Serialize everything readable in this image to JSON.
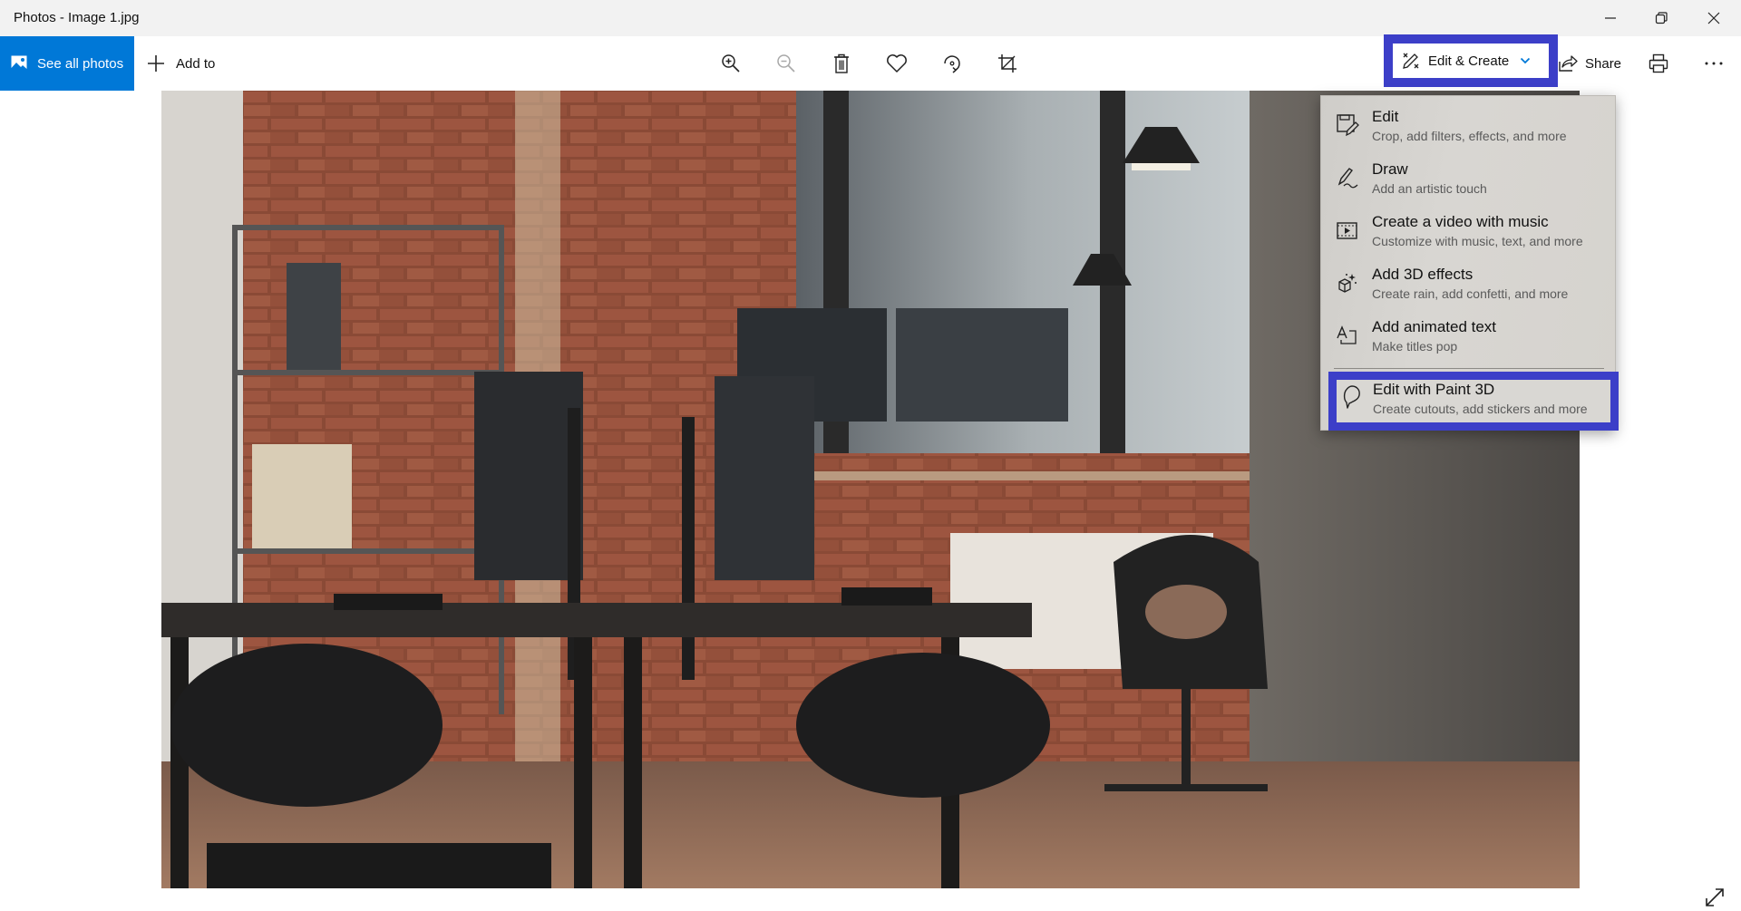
{
  "window": {
    "title": "Photos - Image 1.jpg",
    "controls": [
      {
        "name": "minimize",
        "icon": "minimize-icon"
      },
      {
        "name": "restore",
        "icon": "restore-icon"
      },
      {
        "name": "close",
        "icon": "close-icon"
      }
    ]
  },
  "toolbar": {
    "see_all_photos": "See all photos",
    "add_to": "Add to",
    "icons": [
      "zoom-in-icon",
      "zoom-out-icon",
      "delete-icon",
      "favorite-heart-icon",
      "rotate-icon",
      "crop-icon"
    ],
    "edit_create": "Edit & Create",
    "share": "Share",
    "print": "print-icon",
    "more": "more-options-icon"
  },
  "menu": {
    "items": [
      {
        "title": "Edit",
        "subtitle": "Crop, add filters, effects, and more",
        "icon": "edit-icon"
      },
      {
        "title": "Draw",
        "subtitle": "Add an artistic touch",
        "icon": "draw-pen-icon"
      },
      {
        "title": "Create a video with music",
        "subtitle": "Customize with music, text, and more",
        "icon": "video-icon"
      },
      {
        "title": "Add 3D effects",
        "subtitle": "Create rain, add confetti, and more",
        "icon": "3d-effects-icon"
      },
      {
        "title": "Add animated text",
        "subtitle": "Make titles pop",
        "icon": "animated-text-icon"
      }
    ],
    "paint3d": {
      "title": "Edit with Paint 3D",
      "subtitle": "Create cutouts, add stickers and more",
      "icon": "paint3d-icon"
    }
  },
  "photo": {
    "description": "Office interior with brick wall, desks, monitors and chairs"
  },
  "colors": {
    "accent": "#0078d7",
    "highlight": "#3c3fc8"
  }
}
